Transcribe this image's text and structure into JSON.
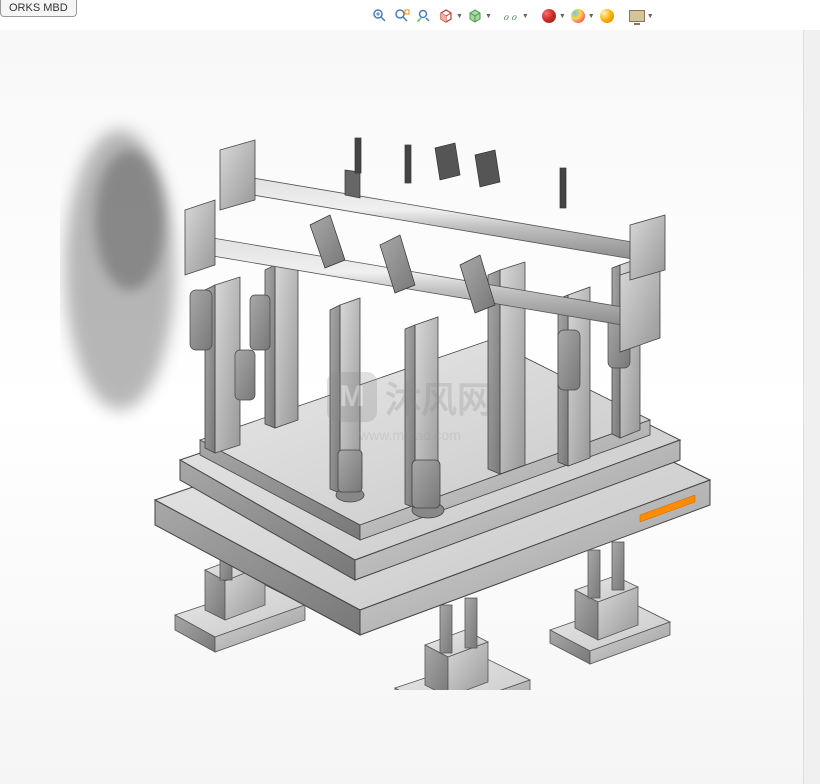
{
  "tabs": {
    "mbd": "ORKS MBD"
  },
  "toolbar": {
    "zoom_fit": "zoom-fit",
    "zoom_area": "zoom-area",
    "prev_view": "previous-view",
    "section": "section-view",
    "display_style": "display-style",
    "hide_show": "hide-show",
    "edit_appearance": "edit-appearance",
    "apply_scene": "apply-scene",
    "view_settings": "view-settings"
  },
  "watermark": {
    "brand": "沐风网",
    "url": "www.mfcad.com",
    "logo_letter": "M"
  }
}
